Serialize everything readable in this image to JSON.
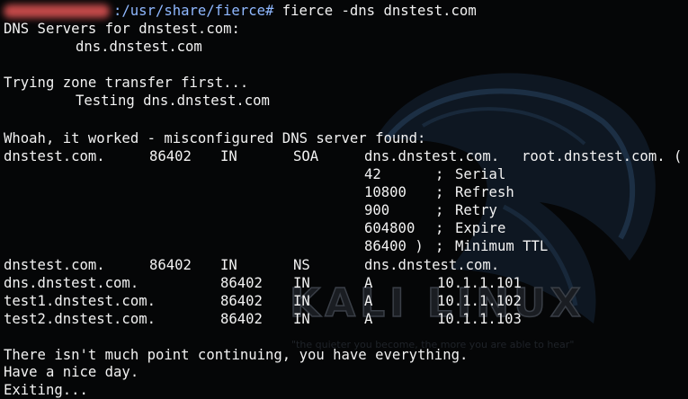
{
  "colors": {
    "background": "#050607",
    "text": "#f2f2f2",
    "prompt_path": "#8fb8ff",
    "prompt_user": "#c44a4a"
  },
  "prompt": {
    "path": ":/usr/share/fierce#",
    "command": "fierce -dns dnstest.com"
  },
  "lines": {
    "dns_servers_header": "DNS Servers for dnstest.com:",
    "dns_server": "dns.dnstest.com",
    "trying_zone": "Trying zone transfer first...",
    "testing": "Testing dns.dnstest.com",
    "whoah": "Whoah, it worked - misconfigured DNS server found:",
    "no_point": "There isn't much point continuing, you have everything.",
    "nice_day": "Have a nice day.",
    "exiting": "Exiting..."
  },
  "soa": {
    "name": "dnstest.com.",
    "ttl": "86402",
    "class": "IN",
    "type": "SOA",
    "mname": "dns.dnstest.com.",
    "rname": "root.dnstest.com. (",
    "fields": [
      {
        "value": "42",
        "sep": ";",
        "label": "Serial"
      },
      {
        "value": "10800",
        "sep": ";",
        "label": "Refresh"
      },
      {
        "value": "900",
        "sep": ";",
        "label": "Retry"
      },
      {
        "value": "604800",
        "sep": ";",
        "label": "Expire"
      },
      {
        "value": "86400 )",
        "sep": ";",
        "label": "Minimum TTL"
      }
    ]
  },
  "ns_record": {
    "name": "dnstest.com.",
    "ttl": "86402",
    "class": "IN",
    "type": "NS",
    "data": "dns.dnstest.com."
  },
  "a_records": [
    {
      "name": "dns.dnstest.com.",
      "ttl": "86402",
      "class": "IN",
      "type": "A",
      "data": "10.1.1.101"
    },
    {
      "name": "test1.dnstest.com.",
      "ttl": "86402",
      "class": "IN",
      "type": "A",
      "data": "10.1.1.102"
    },
    {
      "name": "test2.dnstest.com.",
      "ttl": "86402",
      "class": "IN",
      "type": "A",
      "data": "10.1.1.103"
    }
  ],
  "watermark": {
    "text": "KALI LINUX",
    "tagline": "\"the quieter you become, the more you are able to hear\""
  }
}
